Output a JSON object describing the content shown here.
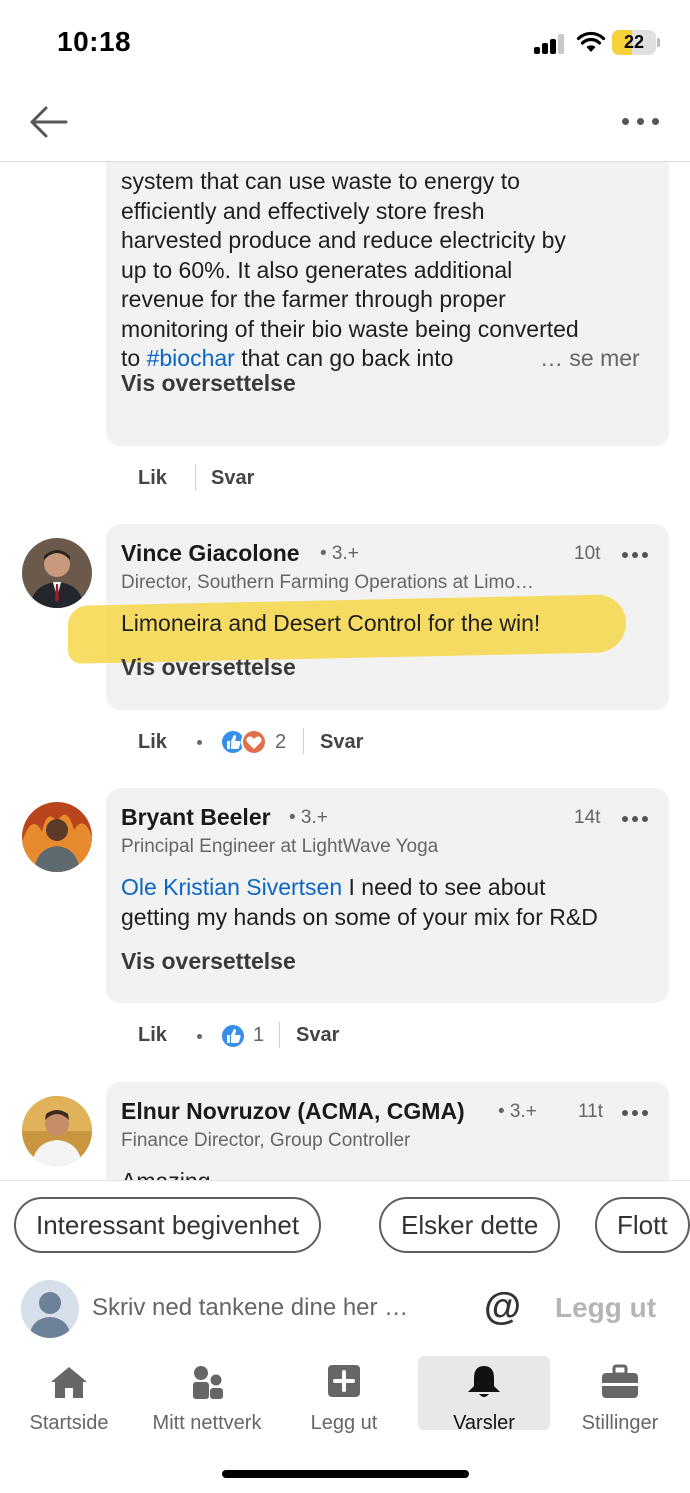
{
  "status_bar": {
    "time": "10:18",
    "battery": "22"
  },
  "post_comment_continued": {
    "text_lines": [
      "system that can use waste to energy to",
      "efficiently and effectively store fresh",
      "harvested produce and reduce electricity by",
      "up to 60%. It also generates additional",
      "revenue for the farmer through proper",
      "monitoring of their bio waste being converted"
    ],
    "last_line_prefix": "to ",
    "hashtag": "#biochar",
    "last_line_suffix": " that can go back into",
    "see_more": "… se mer",
    "translate": "Vis oversettelse",
    "actions": {
      "like": "Lik",
      "reply": "Svar"
    }
  },
  "comments": [
    {
      "name": "Vince Giacolone",
      "degree": "• 3.+",
      "time": "10t",
      "headline": "Director, Southern Farming Operations at Limo…",
      "text": "Limoneira and Desert Control for the win!",
      "translate": "Vis oversettelse",
      "like": "Lik",
      "reactions_count": "2",
      "reply": "Svar"
    },
    {
      "name": "Bryant Beeler",
      "degree": "• 3.+",
      "time": "14t",
      "headline": "Principal Engineer at LightWave Yoga",
      "mention": "Ole Kristian Sivertsen",
      "text_after_mention": " I need to see about",
      "text_line2": "getting my hands on some of your mix for R&D",
      "translate": "Vis oversettelse",
      "like": "Lik",
      "reactions_count": "1",
      "reply": "Svar"
    },
    {
      "name": "Elnur Novruzov (ACMA, CGMA)",
      "degree": "• 3.+",
      "time": "11t",
      "headline": "Finance Director, Group Controller",
      "text": "Amazing"
    }
  ],
  "quick_replies": [
    "Interessant begivenhet",
    "Elsker dette",
    "Flott"
  ],
  "composer": {
    "placeholder": "Skriv ned tankene dine her …",
    "at": "@",
    "post": "Legg ut"
  },
  "tabbar": {
    "items": [
      {
        "label": "Startside",
        "icon": "home-icon"
      },
      {
        "label": "Mitt nettverk",
        "icon": "network-icon"
      },
      {
        "label": "Legg ut",
        "icon": "post-plus-icon"
      },
      {
        "label": "Varsler",
        "icon": "bell-icon",
        "active": true
      },
      {
        "label": "Stillinger",
        "icon": "briefcase-icon"
      }
    ]
  },
  "colors": {
    "link": "#0a66c2",
    "highlight": "#f7d74a",
    "bubble": "#f2f2f2"
  }
}
